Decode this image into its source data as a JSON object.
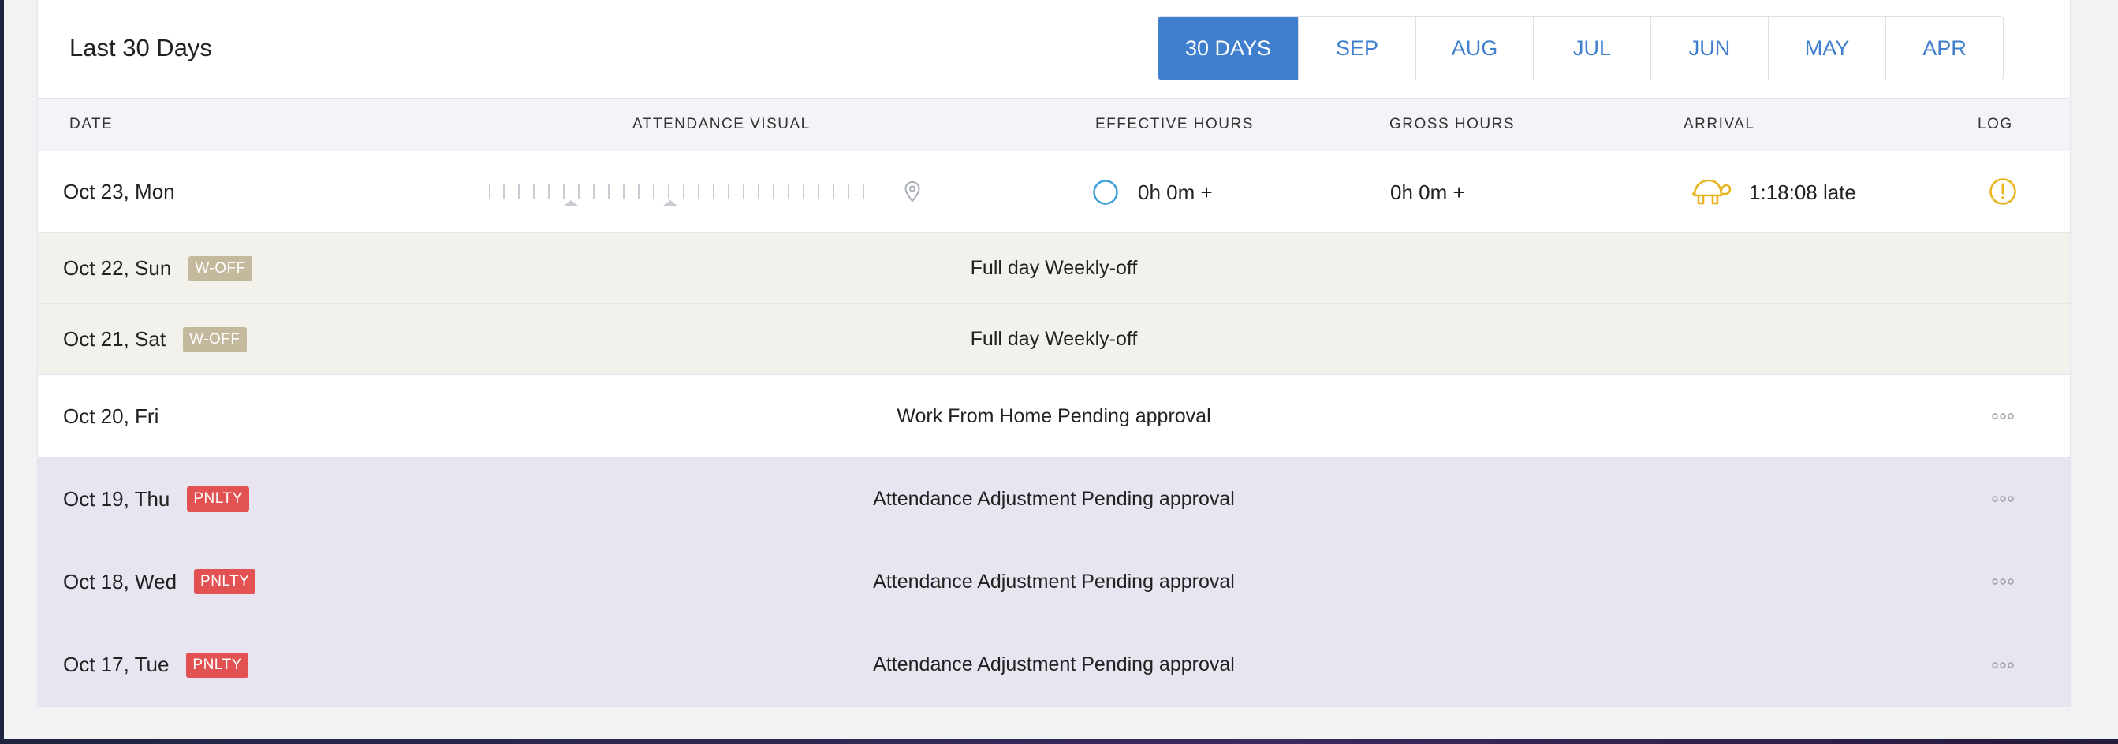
{
  "header": {
    "title": "Last 30 Days",
    "tabs": [
      "30 DAYS",
      "SEP",
      "AUG",
      "JUL",
      "JUN",
      "MAY",
      "APR"
    ],
    "active_tab": "30 DAYS"
  },
  "columns": {
    "date": "DATE",
    "visual": "ATTENDANCE VISUAL",
    "effective": "EFFECTIVE HOURS",
    "gross": "GROSS HOURS",
    "arrival": "ARRIVAL",
    "log": "LOG"
  },
  "today": {
    "date": "Oct 23, Mon",
    "effective_hours": "0h 0m +",
    "gross_hours": "0h 0m +",
    "arrival": "1:18:08 late"
  },
  "rows": [
    {
      "date": "Oct 22, Sun",
      "badge": "W-OFF",
      "status": "Full day Weekly-off"
    },
    {
      "date": "Oct 21, Sat",
      "badge": "W-OFF",
      "status": "Full day Weekly-off"
    },
    {
      "date": "Oct 20, Fri",
      "badge": "",
      "status": "Work From Home Pending approval"
    },
    {
      "date": "Oct 19, Thu",
      "badge": "PNLTY",
      "status": "Attendance Adjustment Pending approval"
    },
    {
      "date": "Oct 18, Wed",
      "badge": "PNLTY",
      "status": "Attendance Adjustment Pending approval"
    },
    {
      "date": "Oct 17, Tue",
      "badge": "PNLTY",
      "status": "Attendance Adjustment Pending approval"
    }
  ],
  "colors": {
    "accent": "#3f7fce",
    "woff_badge": "#c4b89d",
    "penalty_badge": "#e25252",
    "warning": "#e8b421",
    "woff_row_bg": "#f2f1ec",
    "pending_row_bg": "#e9e5f0"
  },
  "icons": {
    "location": "location-pin-icon",
    "effective": "ring-icon",
    "arrival": "turtle-icon",
    "log": "alert-circle-icon",
    "row_menu": "more-options-icon"
  }
}
